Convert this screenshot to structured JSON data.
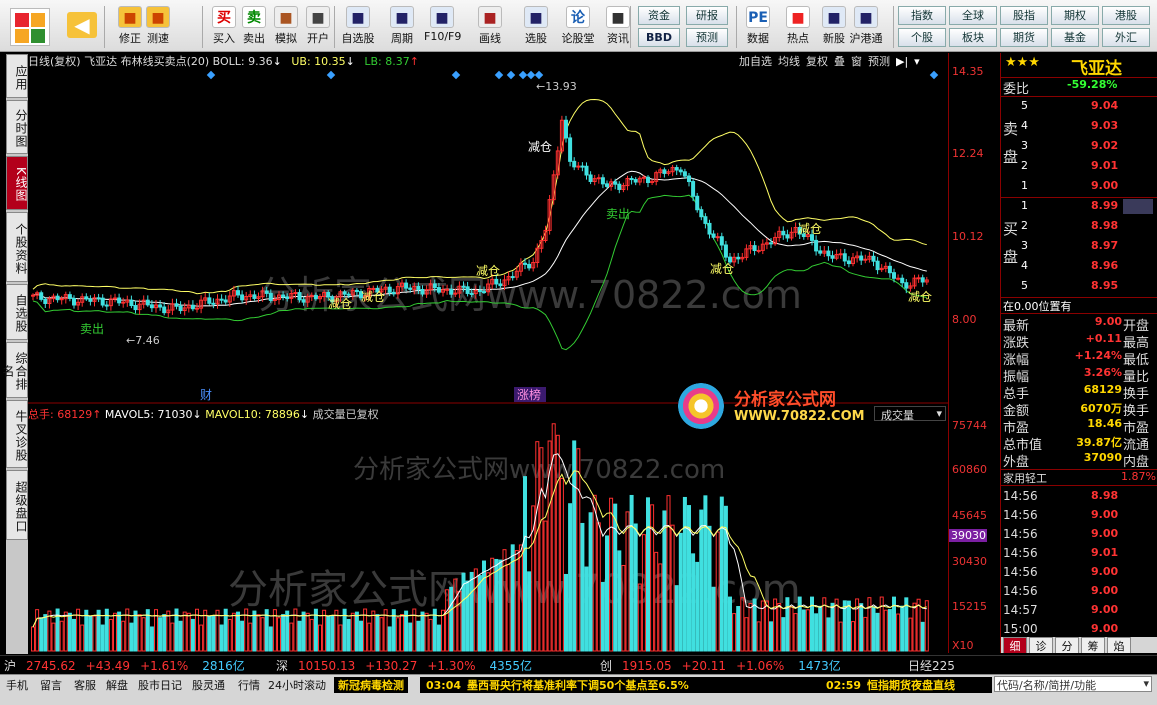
{
  "toolbar": {
    "buttons": [
      {
        "label": "修正",
        "icon": "arrow-up-down-icon"
      },
      {
        "label": "测速",
        "icon": "speed-icon"
      },
      {
        "label": "买入",
        "icon": "buy-icon",
        "glyph": "买"
      },
      {
        "label": "卖出",
        "icon": "sell-icon",
        "glyph": "卖"
      },
      {
        "label": "模拟",
        "icon": "hammer-icon"
      },
      {
        "label": "开户",
        "icon": "lock-icon"
      },
      {
        "label": "自选股",
        "icon": "portfolio-icon"
      },
      {
        "label": "周期",
        "icon": "clock-icon"
      },
      {
        "label": "F10/F9",
        "icon": "f10-icon"
      },
      {
        "label": "画线",
        "icon": "pen-icon"
      },
      {
        "label": "选股",
        "icon": "screen-icon"
      },
      {
        "label": "论股堂",
        "icon": "forum-icon",
        "glyph": "论"
      },
      {
        "label": "资讯",
        "icon": "news-icon"
      },
      {
        "label": "数据",
        "icon": "pe-icon",
        "glyph": "PE"
      },
      {
        "label": "热点",
        "icon": "hot-icon"
      },
      {
        "label": "新股",
        "icon": "new-stock-icon"
      },
      {
        "label": "沪港通",
        "icon": "hk-connect-icon"
      }
    ],
    "mid": [
      "资金",
      "研报",
      "BBD",
      "预测"
    ],
    "grid": [
      "指数",
      "全球",
      "股指",
      "期权",
      "港股",
      "个股",
      "板块",
      "期货",
      "基金",
      "外汇"
    ]
  },
  "left_tabs": [
    "应用",
    "分时图",
    "K线图",
    "个股资料",
    "自选股",
    "综合排名",
    "牛叉诊股",
    "超级盘口"
  ],
  "chart": {
    "header": "日线(复权)  飞亚达  布林线买卖点(20)  BOLL: 9.36",
    "ub": "UB: 10.35",
    "lb": "LB: 8.37",
    "tools": [
      "加自选",
      "均线",
      "复权",
      "叠",
      "窗",
      "预测"
    ],
    "watermark": "分析家公式网www.70822.com",
    "logo_text": "分析家公式网",
    "logo_url": "WWW.70822.COM",
    "high_label": "13.93",
    "low_label": "7.46",
    "marker_cai": "财",
    "marker_zhang": "涨榜",
    "volume_header": "总手: 68129",
    "mavol5": "MAVOL5: 71030",
    "mavol10": "MAVOL10: 78896",
    "vol_suffix": "成交量已复权",
    "vol_select": "成交量",
    "signals": [
      "卖出",
      "减仓",
      "减仓",
      "减仓",
      "减仓",
      "卖出",
      "减仓",
      "减仓",
      "减仓"
    ]
  },
  "chart_data": {
    "type": "candlestick",
    "title": "日线(复权) 飞亚达 布林线买卖点(20)",
    "price_axis": [
      "14.35",
      "12.24",
      "10.12",
      "8.00"
    ],
    "volume_axis": [
      "75744",
      "60860",
      "45645",
      "30430",
      "15215"
    ],
    "volume_marker": "39030",
    "volume_scale": "X10",
    "high": 13.93,
    "low": 7.46,
    "boll": 9.36,
    "ub": 10.35,
    "lb": 8.37,
    "colors": {
      "up": "#ff3030",
      "down": "#40e0e0",
      "mid": "#ffffff",
      "ub": "#ffff66",
      "lb": "#33cc33"
    }
  },
  "quote": {
    "stars": "★★★",
    "name": "飞亚达",
    "weibi_label": "委比",
    "weibi": "-59.28%",
    "sell_label": "卖盘",
    "buy_label": "买盘",
    "asks": [
      [
        "5",
        "9.04"
      ],
      [
        "4",
        "9.03"
      ],
      [
        "3",
        "9.02"
      ],
      [
        "2",
        "9.01"
      ],
      [
        "1",
        "9.00"
      ]
    ],
    "bids": [
      [
        "1",
        "8.99"
      ],
      [
        "2",
        "8.98"
      ],
      [
        "3",
        "8.97"
      ],
      [
        "4",
        "8.96"
      ],
      [
        "5",
        "8.95"
      ]
    ],
    "position_note": "在0.00位置有",
    "stats": [
      {
        "k": "最新",
        "v": "9.00",
        "k2": "开盘"
      },
      {
        "k": "涨跌",
        "v": "+0.11",
        "k2": "最高"
      },
      {
        "k": "涨幅",
        "v": "+1.24%",
        "k2": "最低"
      },
      {
        "k": "振幅",
        "v": "3.26%",
        "k2": "量比"
      },
      {
        "k": "总手",
        "v": "68129",
        "k2": "换手"
      },
      {
        "k": "金额",
        "v": "6070万",
        "k2": "换手"
      },
      {
        "k": "市盈",
        "v": "18.46",
        "k2": "市盈"
      },
      {
        "k": "总市值",
        "v": "39.87亿",
        "k2": "流通"
      },
      {
        "k": "外盘",
        "v": "37090",
        "k2": "内盘"
      }
    ],
    "industry": "家用轻工",
    "industry_change": "1.87%",
    "ticks": [
      [
        "14:56",
        "8.98"
      ],
      [
        "14:56",
        "9.00"
      ],
      [
        "14:56",
        "9.00"
      ],
      [
        "14:56",
        "9.01"
      ],
      [
        "14:56",
        "9.00"
      ],
      [
        "14:56",
        "9.00"
      ],
      [
        "14:57",
        "9.00"
      ],
      [
        "15:00",
        "9.00"
      ]
    ],
    "tabs": [
      "细",
      "诊",
      "分",
      "筹",
      "焰"
    ]
  },
  "index_bar": [
    {
      "name": "沪",
      "value": "2745.62",
      "chg": "+43.49",
      "pct": "+1.61%",
      "amt": "2816亿"
    },
    {
      "name": "深",
      "value": "10150.13",
      "chg": "+130.27",
      "pct": "+1.30%",
      "amt": "4355亿"
    },
    {
      "name": "创",
      "value": "1915.05",
      "chg": "+20.11",
      "pct": "+1.06%",
      "amt": "1473亿"
    }
  ],
  "index_tail": "日经225",
  "status": {
    "items": [
      "手机",
      "留言",
      "客服",
      "解盘",
      "股市日记",
      "股灵通",
      "行情",
      "24小时滚动"
    ],
    "news1": "新冠病毒检测",
    "time2": "03:04",
    "news2": "墨西哥央行将基准利率下调50个基点至6.5%",
    "time3": "02:59",
    "news3": "恒指期货夜盘直线",
    "search": "代码/名称/简拼/功能"
  }
}
